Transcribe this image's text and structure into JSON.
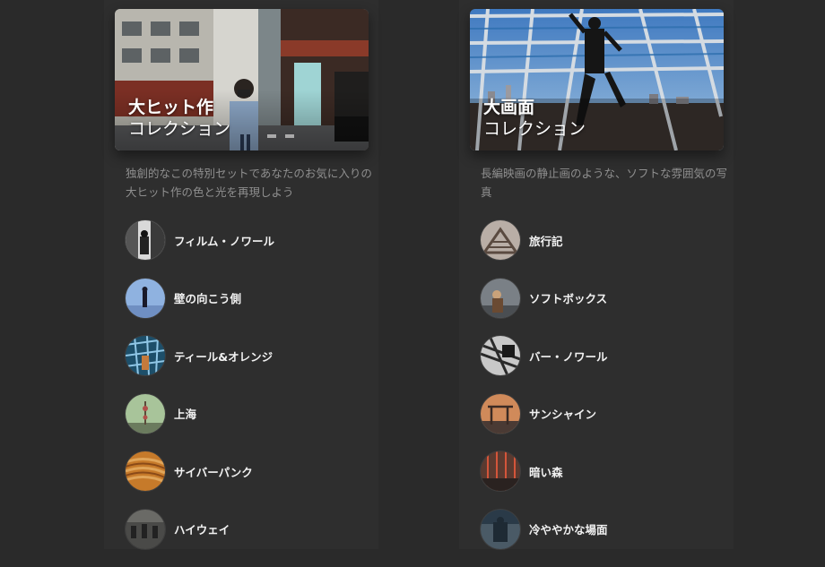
{
  "collections": [
    {
      "title": "大ヒット作",
      "subtitle": "コレクション",
      "description": "独創的なこの特別セットであなたのお気に入りの大ヒット作の色と光を再現しよう",
      "items": [
        {
          "label": "フィルム・ノワール"
        },
        {
          "label": "壁の向こう側"
        },
        {
          "label": "ティール&オレンジ"
        },
        {
          "label": "上海"
        },
        {
          "label": "サイバーパンク"
        },
        {
          "label": "ハイウェイ"
        }
      ]
    },
    {
      "title": "大画面",
      "subtitle": "コレクション",
      "description": "長編映画の静止画のような、ソフトな雰囲気の写真",
      "items": [
        {
          "label": "旅行記"
        },
        {
          "label": "ソフトボックス"
        },
        {
          "label": "バー・ノワール"
        },
        {
          "label": "サンシャイン"
        },
        {
          "label": "暗い森"
        },
        {
          "label": "冷ややかな場面"
        }
      ]
    }
  ]
}
